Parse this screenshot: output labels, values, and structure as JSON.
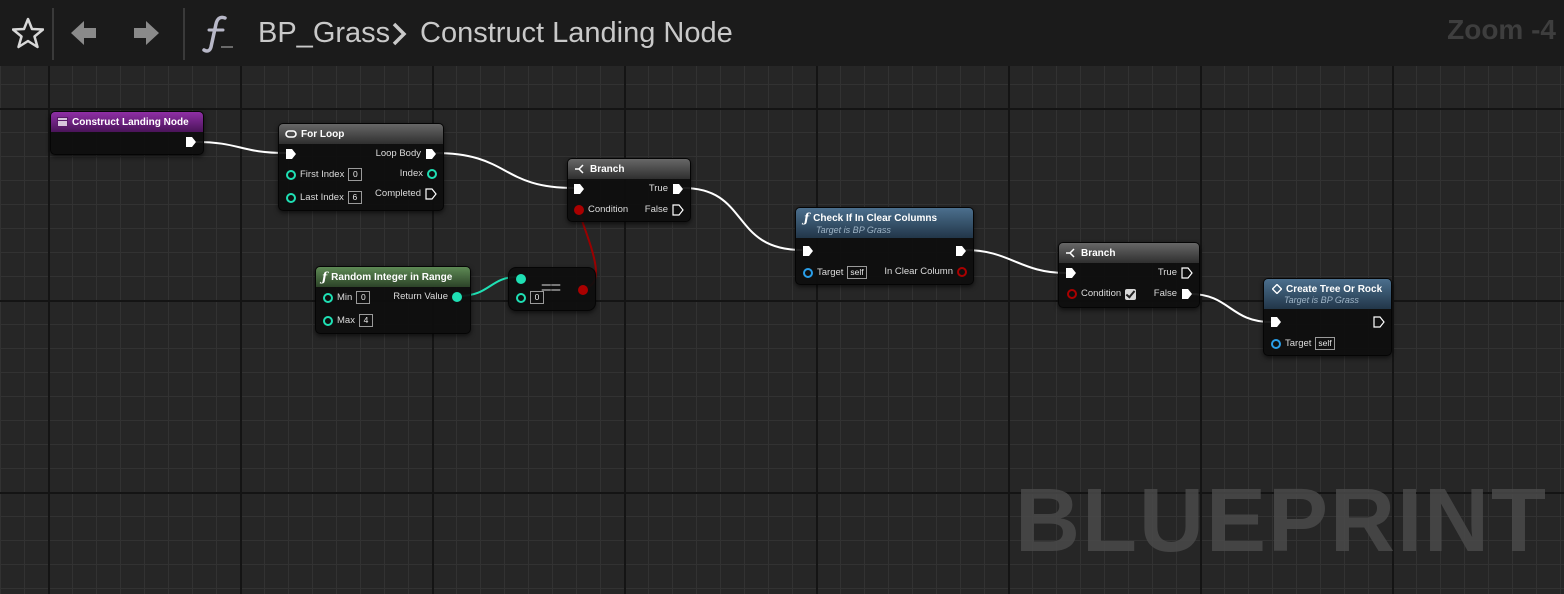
{
  "toolbar": {
    "breadcrumb_root": "BP_Grass",
    "breadcrumb_current": "Construct Landing Node",
    "zoom": "Zoom -4",
    "icons": [
      "star-icon",
      "back-arrow-icon",
      "forward-arrow-icon",
      "function-icon",
      "chevron-right-icon"
    ]
  },
  "watermark": "BLUEPRINT",
  "colors": {
    "exec": "#ffffff",
    "int": "#1fe0b4",
    "bool": "#aa0000",
    "object": "#2a9ee8",
    "event_header": "#7f2796",
    "function_header": "#3f6383",
    "pure_header": "#4a7a3f"
  },
  "nodes": {
    "construct": {
      "title": "Construct Landing Node"
    },
    "forloop": {
      "title": "For Loop",
      "first_index": "First Index",
      "first_index_val": "0",
      "last_index": "Last Index",
      "last_index_val": "6",
      "loop_body": "Loop Body",
      "index": "Index",
      "completed": "Completed"
    },
    "branch1": {
      "title": "Branch",
      "condition": "Condition",
      "true": "True",
      "false": "False"
    },
    "random": {
      "title": "Random Integer in Range",
      "min": "Min",
      "min_val": "0",
      "max": "Max",
      "max_val": "4",
      "return_value": "Return Value"
    },
    "equal": {
      "symbol": "==",
      "b_val": "0"
    },
    "check": {
      "title": "Check If In Clear Columns",
      "subtitle": "Target is BP Grass",
      "target": "Target",
      "target_val": "self",
      "output": "In Clear Column"
    },
    "branch2": {
      "title": "Branch",
      "condition": "Condition",
      "true": "True",
      "false": "False"
    },
    "create": {
      "title": "Create Tree Or Rock",
      "subtitle": "Target is BP Grass",
      "target": "Target",
      "target_val": "self"
    }
  }
}
